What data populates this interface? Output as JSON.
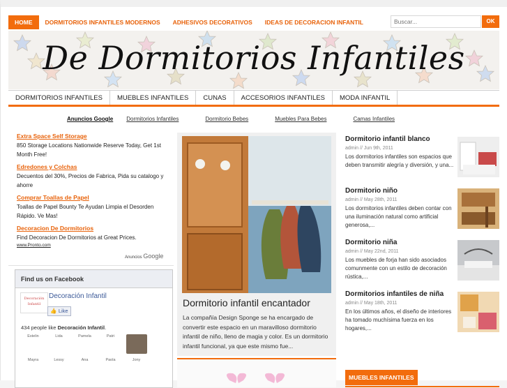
{
  "topnav": {
    "items": [
      "HOME",
      "DORMITORIOS INFANTILES MODERNOS",
      "ADHESIVOS DECORATIVOS",
      "IDEAS DE DECORACION INFANTIL"
    ],
    "search_placeholder": "Buscar...",
    "search_button": "OK"
  },
  "banner": {
    "title": "De Dormitorios Infantiles"
  },
  "catnav": {
    "items": [
      "DORMITORIOS INFANTILES",
      "MUEBLES INFANTILES",
      "CUNAS",
      "ACCESORIOS INFANTILES",
      "MODA INFANTIL"
    ]
  },
  "adlinks": {
    "label": "Anuncios Google",
    "links": [
      "Dormitorios Infantiles",
      "Dormitorio Bebes",
      "Muebles Para Bebes",
      "Camas Infantiles"
    ]
  },
  "ads": [
    {
      "title": "Extra Space Self Storage",
      "desc": "850 Storage Locations Nationwide Reserve Today, Get 1st Month Free!"
    },
    {
      "title": "Edredones y Colchas",
      "desc": "Decuentos del 30%, Precios de Fabrica, Pida su catalogo y ahorre"
    },
    {
      "title": "Comprar Toallas de Papel",
      "desc": "Toallas de Papel Bounty Te Ayudan Limpia el Desorden Rápido. Ve Mas!"
    },
    {
      "title": "Decoracion De Dormitorios",
      "desc": "Find Decoracion De Dormitorios at Great Prices.",
      "url": "www.Pronto.com"
    }
  ],
  "adsby": {
    "prefix": "Anuncios",
    "brand": "Google"
  },
  "facebook": {
    "header": "Find us on Facebook",
    "page_name": "Decoración Infantil",
    "page_logo_text": "Decoración Infantil",
    "like": "Like",
    "count_prefix": "434 people like",
    "count_page": "Decoración Infantil",
    "faces": [
      "Estelin",
      "Lida",
      "Pamela",
      "Patri",
      "",
      "Mayra",
      "Lessy",
      "Ana",
      "Paola",
      "Jony"
    ]
  },
  "featured": {
    "title": "Dormitorio infantil encantador",
    "body": "La compañía Design Sponge se ha encargado de convertir este espacio en un maravilloso dormitorio infantil de niño, lleno de magia y color. Es un dormitorio infantil funcional, ya que este mismo fue..."
  },
  "posts": [
    {
      "title": "Dormitorio infantil blanco",
      "meta": "admin // Jun 9th, 2011",
      "excerpt": "Los dormitorios infantiles son espacios que deben transmitir alegría y diversión, y una..."
    },
    {
      "title": "Dormitorio niño",
      "meta": "admin // May 28th, 2011",
      "excerpt": "Los dormitorios infantiles deben contar con una iluminación natural como  artificial generosa,..."
    },
    {
      "title": "Dormitorio niña",
      "meta": "admin // May 22nd, 2011",
      "excerpt": "Los muebles de forja han sido asociados comunmente con un estilo de decoración rústica,..."
    },
    {
      "title": "Dormitorios infantiles de niña",
      "meta": "admin // May 18th, 2011",
      "excerpt": "En los últimos años, el diseño de interiores ha tomado muchísima fuerza en los hogares,..."
    }
  ],
  "sections": {
    "muebles": "MUEBLES INFANTILES"
  },
  "colors": {
    "accent": "#f26c0d",
    "link": "#e8620a",
    "facebook": "#3b5998"
  }
}
